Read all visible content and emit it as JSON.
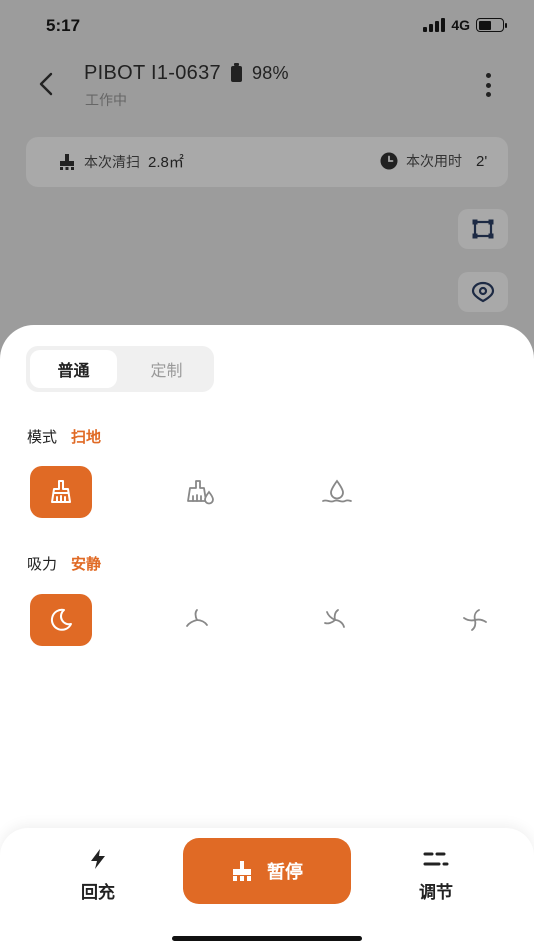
{
  "status_bar": {
    "time": "5:17",
    "network": "4G"
  },
  "header": {
    "title": "PIBOT I1-0637",
    "battery": "98%",
    "status": "工作中"
  },
  "stats": {
    "area_label": "本次清扫",
    "area_value": "2.8㎡",
    "time_label": "本次用时",
    "time_value": "2'"
  },
  "map_tools": {
    "icons": [
      "crop-frame-icon",
      "location-pin-icon"
    ]
  },
  "sheet": {
    "tabs": [
      {
        "label": "普通",
        "active": true
      },
      {
        "label": "定制",
        "active": false
      }
    ],
    "mode": {
      "label": "模式",
      "value": "扫地",
      "options": [
        {
          "icon": "broom-icon",
          "active": true
        },
        {
          "icon": "sweep-and-mop-icon",
          "active": false
        },
        {
          "icon": "mop-drop-icon",
          "active": false
        }
      ]
    },
    "suction": {
      "label": "吸力",
      "value": "安静",
      "options": [
        {
          "icon": "moon-quiet-icon",
          "active": true
        },
        {
          "icon": "fan-low-icon",
          "active": false
        },
        {
          "icon": "fan-medium-icon",
          "active": false
        },
        {
          "icon": "fan-high-icon",
          "active": false
        }
      ]
    }
  },
  "bottom_bar": {
    "recharge_label": "回充",
    "pause_label": "暂停",
    "adjust_label": "调节"
  },
  "colors": {
    "accent": "#e06a25",
    "overlay": "#9c9c9c"
  }
}
